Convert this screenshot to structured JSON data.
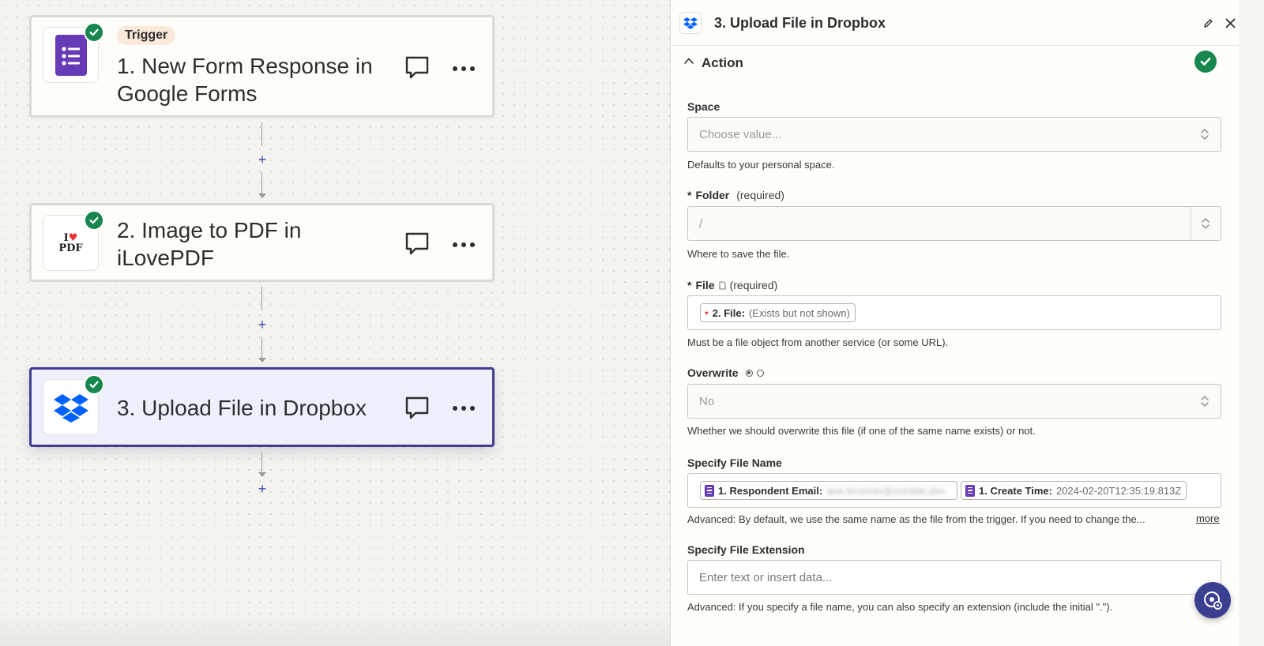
{
  "steps": [
    {
      "trigger_label": "Trigger",
      "title_line1": "1. New Form Response in",
      "title_line2": "Google Forms",
      "app_icon": "google-forms-icon",
      "status_icon": "check-icon"
    },
    {
      "title_line1": "2. Image to PDF in",
      "title_line2": "iLovePDF",
      "app_icon": "ilovepdf-icon",
      "logo_text_top": "I",
      "logo_text_bottom": "PDF",
      "status_icon": "check-icon"
    },
    {
      "title_line1": "3. Upload File in Dropbox",
      "app_icon": "dropbox-icon",
      "status_icon": "check-icon"
    }
  ],
  "connectors": [
    {
      "plus": "+"
    },
    {
      "plus": "+"
    },
    {
      "plus": "+"
    }
  ],
  "panel": {
    "title": "3. Upload File in Dropbox",
    "section_title": "Action",
    "fields": {
      "space": {
        "label": "Space",
        "placeholder": "Choose value...",
        "help": "Defaults to your personal space."
      },
      "folder": {
        "star": "*",
        "label": "Folder",
        "required": "(required)",
        "value": "/",
        "help": "Where to save the file."
      },
      "file": {
        "star": "*",
        "label": "File",
        "required": "(required)",
        "pill_label": "2. File:",
        "pill_value": "(Exists but not shown)",
        "help": "Must be a file object from another service (or some URL)."
      },
      "overwrite": {
        "label": "Overwrite",
        "value": "No",
        "help": "Whether we should overwrite this file (if one of the same name exists) or not."
      },
      "file_name": {
        "label": "Specify File Name",
        "pill1_label": "1. Respondent Email:",
        "pill1_value": "ana.lecomte@zombie.dev",
        "pill2_label": "1. Create Time:",
        "pill2_value": "2024-02-20T12:35:19.813Z",
        "help": "Advanced: By default, we use the same name as the file from the trigger. If you need to change the...",
        "more": "more"
      },
      "file_extension": {
        "label": "Specify File Extension",
        "placeholder": "Enter text or insert data...",
        "help": "Advanced: If you specify a file name, you can also specify an extension (include the initial \".\")."
      }
    }
  },
  "colors": {
    "success": "#17874f",
    "accent": "#3f3f8f",
    "forms_purple": "#673ab7",
    "dropbox_blue": "#0061fe",
    "plus_blue": "#3d4bb0"
  }
}
